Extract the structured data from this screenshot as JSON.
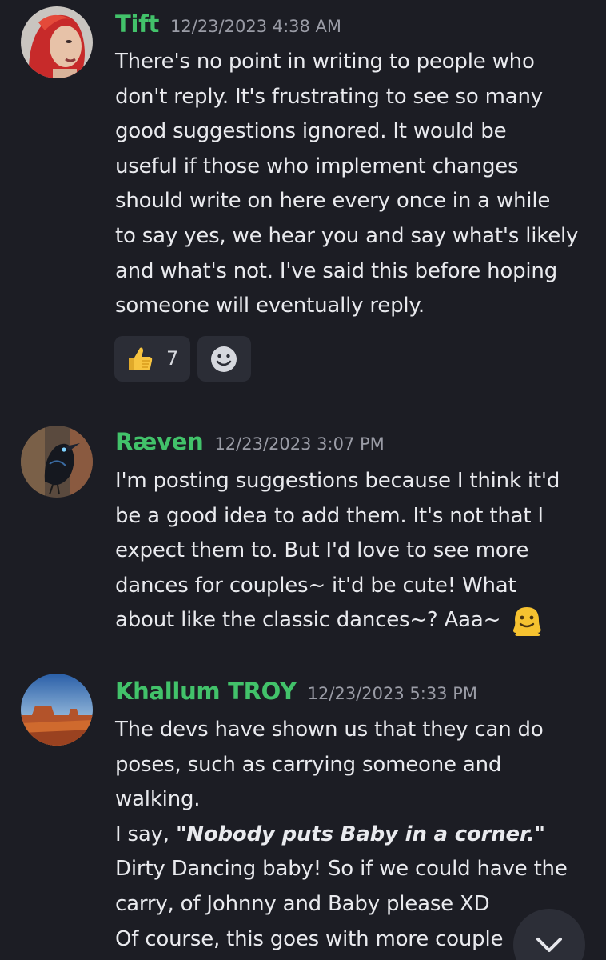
{
  "messages": [
    {
      "username": "Tift",
      "timestamp": "12/23/2023 4:38 AM",
      "lines": [
        "There's no point in writing to people who",
        "don't reply.  It's frustrating to see so many",
        "good suggestions ignored.  It would be",
        "useful if those who implement changes",
        "should write on here every once in a while",
        "to say yes, we hear you and say what's likely",
        "and what's not.  I've said this before hoping",
        "someone will eventually reply."
      ],
      "reactions": [
        {
          "icon": "thumbs-up-icon",
          "count": "7"
        }
      ],
      "add_reaction_icon": "add-reaction-smiley-icon"
    },
    {
      "username": "Ræven",
      "timestamp": "12/23/2023 3:07 PM",
      "lines": [
        "I'm posting suggestions because I think it'd",
        "be a good idea to add them. It's not that I",
        "expect them to. But I'd love to see more",
        "dances for couples~ it'd be cute! What",
        "about like the classic dances~? Aaa~"
      ],
      "inline_emoji": "melting-face-icon"
    },
    {
      "username": "Khallum TROY",
      "timestamp": "12/23/2023 5:33 PM",
      "lines": [
        "The devs have shown us that they can do",
        "poses, such as carrying someone and",
        "walking.",
        "I say, ",
        "Dirty Dancing baby! So if we could have the",
        "carry, of Johnny and Baby please XD",
        "Of course, this goes with more couple"
      ],
      "quote": "\"Nobody puts Baby in a corner.\""
    }
  ],
  "scroll_button_icon": "chevron-down-icon",
  "colors": {
    "background": "#1c1d24",
    "username": "#42c26a",
    "timestamp": "#9a9ca6",
    "text": "#e9eaee",
    "reaction_bg": "#2b2d36"
  }
}
